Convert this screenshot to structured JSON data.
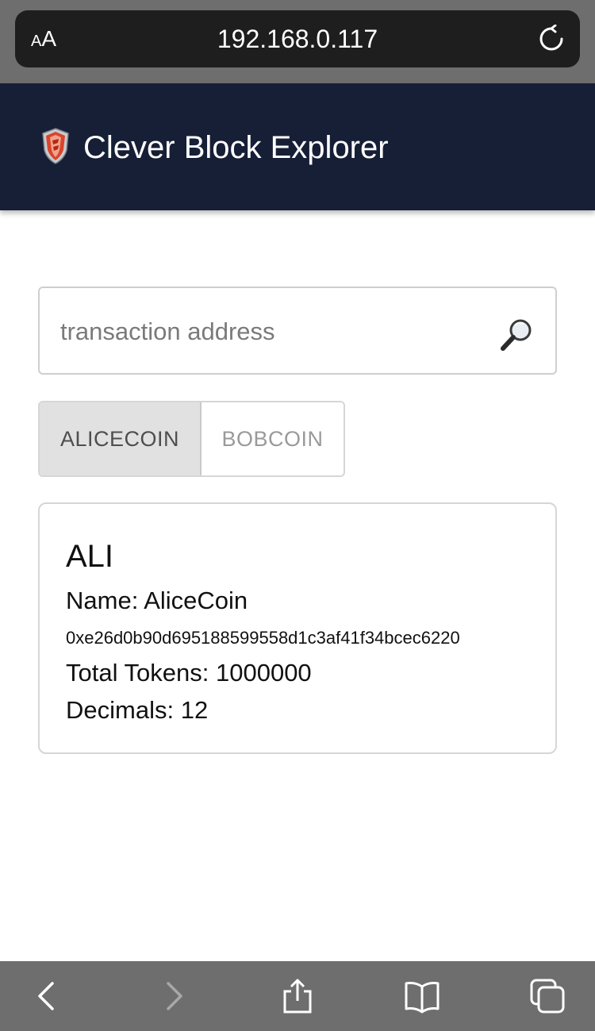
{
  "browser": {
    "text_size_label_small": "A",
    "text_size_label_large": "A",
    "url": "192.168.0.117",
    "toolbar_icons": [
      "back-icon",
      "forward-icon",
      "share-icon",
      "bookmarks-icon",
      "tabs-icon"
    ]
  },
  "header": {
    "logo_icon": "shield-icon",
    "title": "Clever Block Explorer"
  },
  "search": {
    "placeholder": "transaction address",
    "value": "",
    "icon": "magnifier-icon"
  },
  "coin_tabs": {
    "options": [
      "ALICECOIN",
      "BOBCOIN"
    ],
    "selected": "ALICECOIN"
  },
  "coin": {
    "symbol": "ALI",
    "name_label": "Name: ",
    "name": "AliceCoin",
    "address": "0xe26d0b90d695188599558d1c3af41f34bcec6220",
    "total_tokens_label": "Total Tokens: ",
    "total_tokens": "1000000",
    "decimals_label": "Decimals: ",
    "decimals": "12"
  },
  "colors": {
    "header_bg": "#171f36",
    "browser_chrome": "#6e6e6e",
    "url_bar": "#1e1e1e",
    "active_tab_bg": "#e1e1e1"
  }
}
